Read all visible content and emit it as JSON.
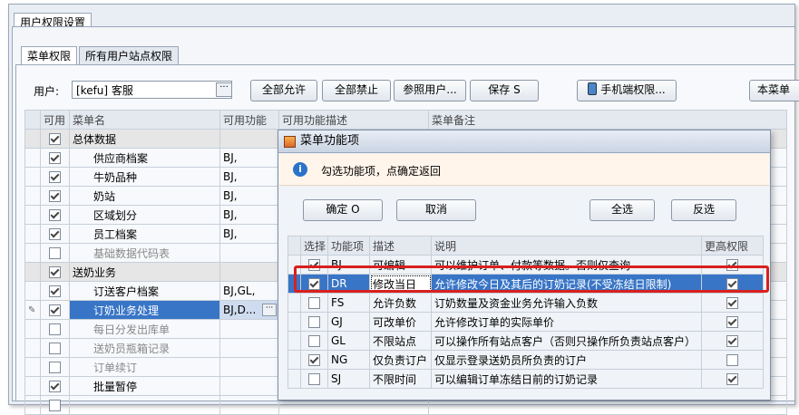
{
  "window": {
    "tab_title": "用户权限设置"
  },
  "tabs": [
    {
      "label": "菜单权限"
    },
    {
      "label": "所有用户站点权限"
    }
  ],
  "toolbar": {
    "user_label": "用户:",
    "user_value": "[kefu] 客服",
    "allow_all": "全部允许",
    "deny_all": "全部禁止",
    "ref_user": "参照用户...",
    "save": "保存 S",
    "mobile_perm": "手机端权限...",
    "cut_button": "本菜单"
  },
  "menu_grid": {
    "columns": [
      "可用",
      "菜单名",
      "可用功能",
      "可用功能描述",
      "菜单备注"
    ],
    "rows": [
      {
        "checked": true,
        "name": "总体数据",
        "funcs": "",
        "group": true,
        "dim": false
      },
      {
        "checked": true,
        "name": "供应商档案",
        "funcs": "BJ,",
        "group": false,
        "dim": false
      },
      {
        "checked": true,
        "name": "牛奶品种",
        "funcs": "BJ,",
        "group": false,
        "dim": false
      },
      {
        "checked": true,
        "name": "奶站",
        "funcs": "BJ,",
        "group": false,
        "dim": false
      },
      {
        "checked": true,
        "name": "区域划分",
        "funcs": "BJ,",
        "group": false,
        "dim": false
      },
      {
        "checked": true,
        "name": "员工档案",
        "funcs": "BJ,",
        "group": false,
        "dim": false
      },
      {
        "checked": false,
        "name": "基础数据代码表",
        "funcs": "",
        "group": false,
        "dim": true
      },
      {
        "checked": true,
        "name": "送奶业务",
        "funcs": "",
        "group": true,
        "dim": false
      },
      {
        "checked": true,
        "name": "订送客户档案",
        "funcs": "BJ,GL,",
        "group": false,
        "dim": false
      },
      {
        "checked": true,
        "name": "订奶业务处理",
        "funcs": "BJ,D...",
        "group": false,
        "dim": false,
        "selected": true
      },
      {
        "checked": false,
        "name": "每日分发出库单",
        "funcs": "",
        "group": false,
        "dim": true
      },
      {
        "checked": false,
        "name": "送奶员瓶箱记录",
        "funcs": "",
        "group": false,
        "dim": true
      },
      {
        "checked": false,
        "name": "订单续订",
        "funcs": "",
        "group": false,
        "dim": true
      },
      {
        "checked": true,
        "name": "批量暂停",
        "funcs": "",
        "group": false,
        "dim": false
      },
      {
        "checked": false,
        "name": "",
        "funcs": "",
        "group": false,
        "dim": false
      }
    ]
  },
  "dialog": {
    "title": "菜单功能项",
    "info": "勾选功能项，点确定返回",
    "ok": "确定 O",
    "cancel": "取消",
    "select_all": "全选",
    "invert": "反选",
    "columns": [
      "选择",
      "功能项",
      "描述",
      "说明",
      "更高权限"
    ],
    "rows": [
      {
        "sel": true,
        "code": "BJ",
        "desc": "可编辑",
        "note": "可以维护订单、付款等数据。否则仅查询",
        "higher": true
      },
      {
        "sel": true,
        "code": "DR",
        "desc": "修改当日",
        "note": "允许修改今日及其后的订奶记录(不受冻结日限制)",
        "higher": true,
        "selected": true
      },
      {
        "sel": false,
        "code": "FS",
        "desc": "允许负数",
        "note": "订奶数量及资金业务允许输入负数",
        "higher": true
      },
      {
        "sel": false,
        "code": "GJ",
        "desc": "可改单价",
        "note": "允许修改订单的实际单价",
        "higher": true
      },
      {
        "sel": false,
        "code": "GL",
        "desc": "不限站点",
        "note": "可以操作所有站点客户（否则只操作所负责站点客户）",
        "higher": true
      },
      {
        "sel": true,
        "code": "NG",
        "desc": "仅负责订户",
        "note": "仅显示登录送奶员所负责的订户",
        "higher": false
      },
      {
        "sel": false,
        "code": "SJ",
        "desc": "不限时间",
        "note": "可以编辑订单冻结日前的订奶记录",
        "higher": true
      }
    ]
  },
  "colors": {
    "selection": "#3875c6",
    "highlight_box": "#d8201f",
    "info_icon": "#2a73c9"
  }
}
